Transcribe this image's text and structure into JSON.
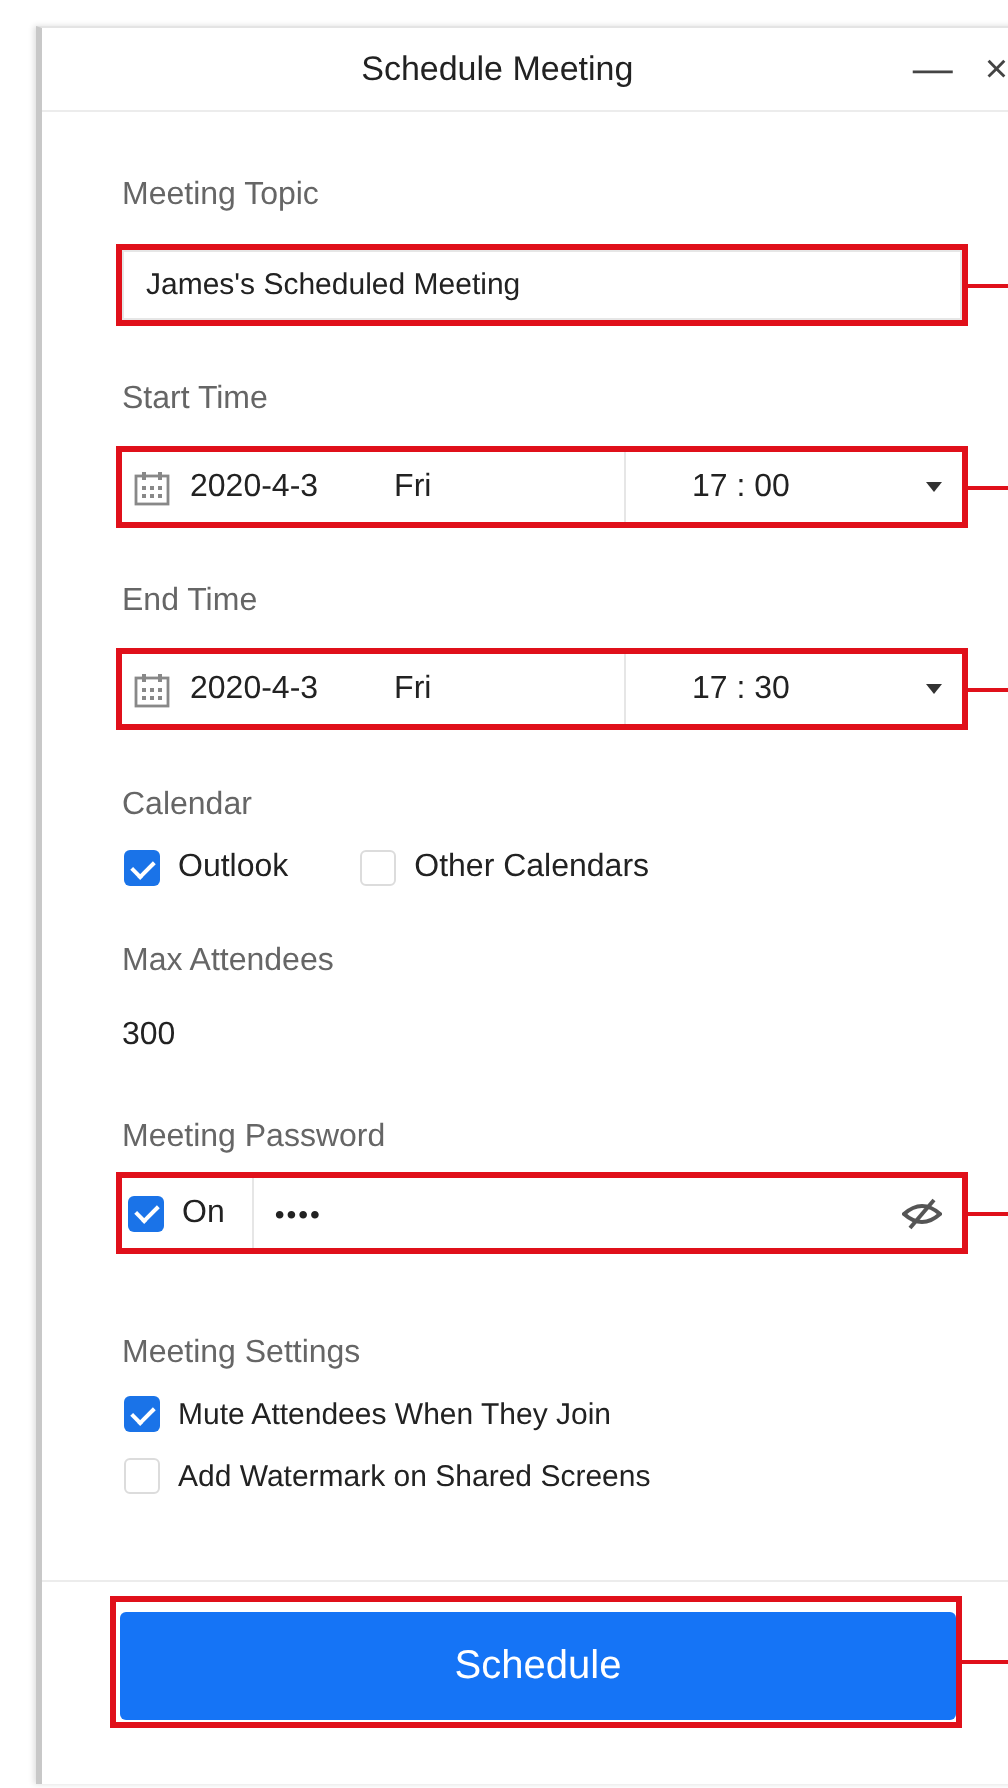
{
  "window": {
    "title": "Schedule Meeting",
    "controls": [
      "—",
      "×"
    ]
  },
  "topic": {
    "label": "Meeting Topic",
    "value": "James's Scheduled Meeting",
    "callout": true
  },
  "start_time": {
    "label": "Start Time",
    "date": "2020-4-3",
    "weekday": "Fri",
    "time": "17 : 00",
    "callout": true
  },
  "end_time": {
    "label": "End Time",
    "date": "2020-4-3",
    "weekday": "Fri",
    "time": "17 : 30",
    "callout": true
  },
  "calendar": {
    "label": "Calendar",
    "options": [
      {
        "label": "Outlook",
        "checked": true
      },
      {
        "label": "Other Calendars",
        "checked": false
      }
    ]
  },
  "max_attendees": {
    "label": "Max Attendees",
    "value": "300"
  },
  "password": {
    "label": "Meeting Password",
    "toggle": {
      "label": "On",
      "checked": true
    },
    "value": "••••",
    "callout": true
  },
  "settings": {
    "label": "Meeting Settings",
    "options": [
      {
        "label": "Mute Attendees When They Join",
        "checked": true
      },
      {
        "label": "Add Watermark on Shared Screens",
        "checked": false
      }
    ]
  },
  "schedule_button": {
    "label": "Schedule",
    "callout": true
  }
}
